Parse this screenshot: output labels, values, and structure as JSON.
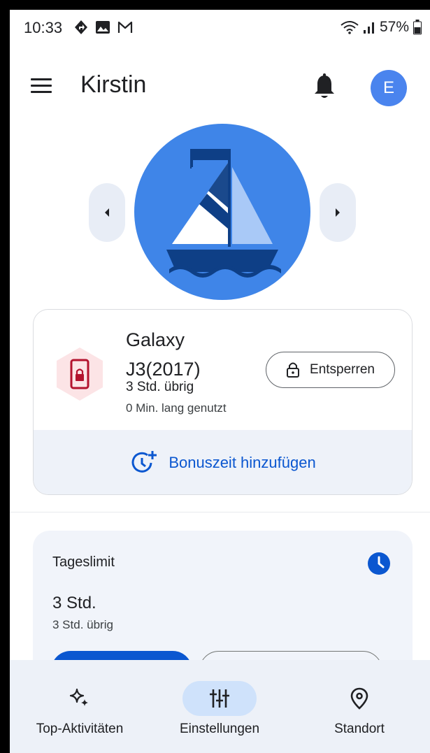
{
  "status_bar": {
    "time": "10:33",
    "battery": "57%",
    "icons": [
      "navigation-icon",
      "image-icon",
      "gmail-icon",
      "wifi-icon",
      "signal-icon",
      "battery-icon"
    ]
  },
  "header": {
    "title": "Kirstin",
    "avatar_letter": "E",
    "menu_icon": "menu-icon",
    "notification_icon": "bell-icon"
  },
  "carousel": {
    "prev_icon": "chevron-left-icon",
    "next_icon": "chevron-right-icon",
    "hero_icon": "sailboat-icon"
  },
  "device": {
    "name": "Galaxy J3(2017)",
    "remaining": "3 Std. übrig",
    "used": "0 Min. lang genutzt",
    "unlock_label": "Entsperren",
    "bonus_label": "Bonuszeit hinzufügen"
  },
  "daily_limit": {
    "title": "Tageslimit",
    "value": "3 Std.",
    "remaining": "3 Std. übrig"
  },
  "bottom_nav": {
    "items": [
      {
        "label": "Top-Aktivitäten",
        "icon": "sparkle-icon",
        "active": false
      },
      {
        "label": "Einstellungen",
        "icon": "tune-icon",
        "active": true
      },
      {
        "label": "Standort",
        "icon": "location-pin-icon",
        "active": false
      }
    ]
  },
  "colors": {
    "accent": "#0b57d0",
    "avatar": "#4a84ee",
    "hero_bg": "#3f85e8",
    "device_icon_bg": "#fce4e6",
    "device_icon_fg": "#b3132e",
    "nav_bg": "#edf1f8",
    "nav_active": "#cfe2fb"
  }
}
